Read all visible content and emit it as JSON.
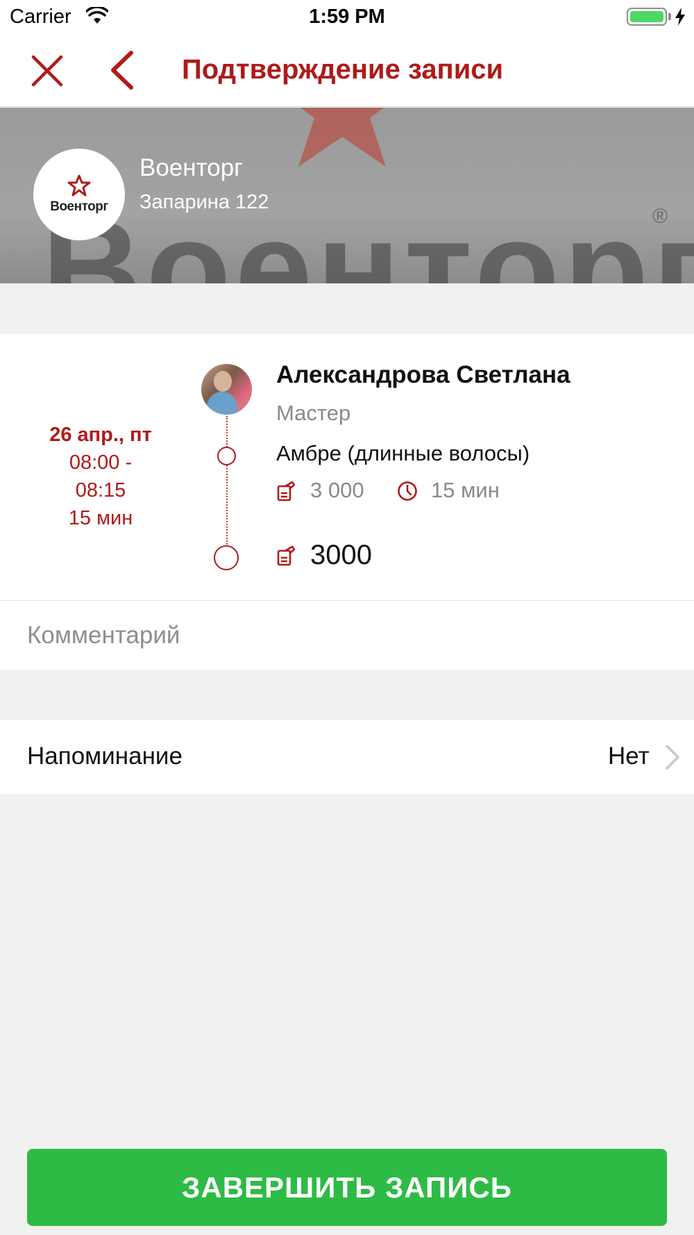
{
  "status_bar": {
    "carrier": "Carrier",
    "time": "1:59 PM"
  },
  "nav": {
    "title": "Подтверждение записи"
  },
  "shop": {
    "logo_text": "Военторг",
    "banner_text": "Военторг",
    "banner_mark": "®",
    "name": "Военторг",
    "address": "Запарина 122"
  },
  "appointment": {
    "date": "26 апр., пт",
    "time_range_start": "08:00 -",
    "time_range_end": "08:15",
    "duration": "15 мин",
    "master_name": "Александрова Светлана",
    "master_role": "Мастер",
    "service_name": "Амбре (длинные волосы)",
    "service_price": "3 000",
    "service_duration": "15 мин",
    "total_price": "3000"
  },
  "comment": {
    "placeholder": "Комментарий",
    "value": ""
  },
  "reminder": {
    "label": "Напоминание",
    "value": "Нет"
  },
  "actions": {
    "finish_label": "ЗАВЕРШИТЬ ЗАПИСЬ"
  },
  "colors": {
    "accent": "#b01a1a",
    "button": "#2dbb45",
    "background": "#f1f1f1"
  }
}
